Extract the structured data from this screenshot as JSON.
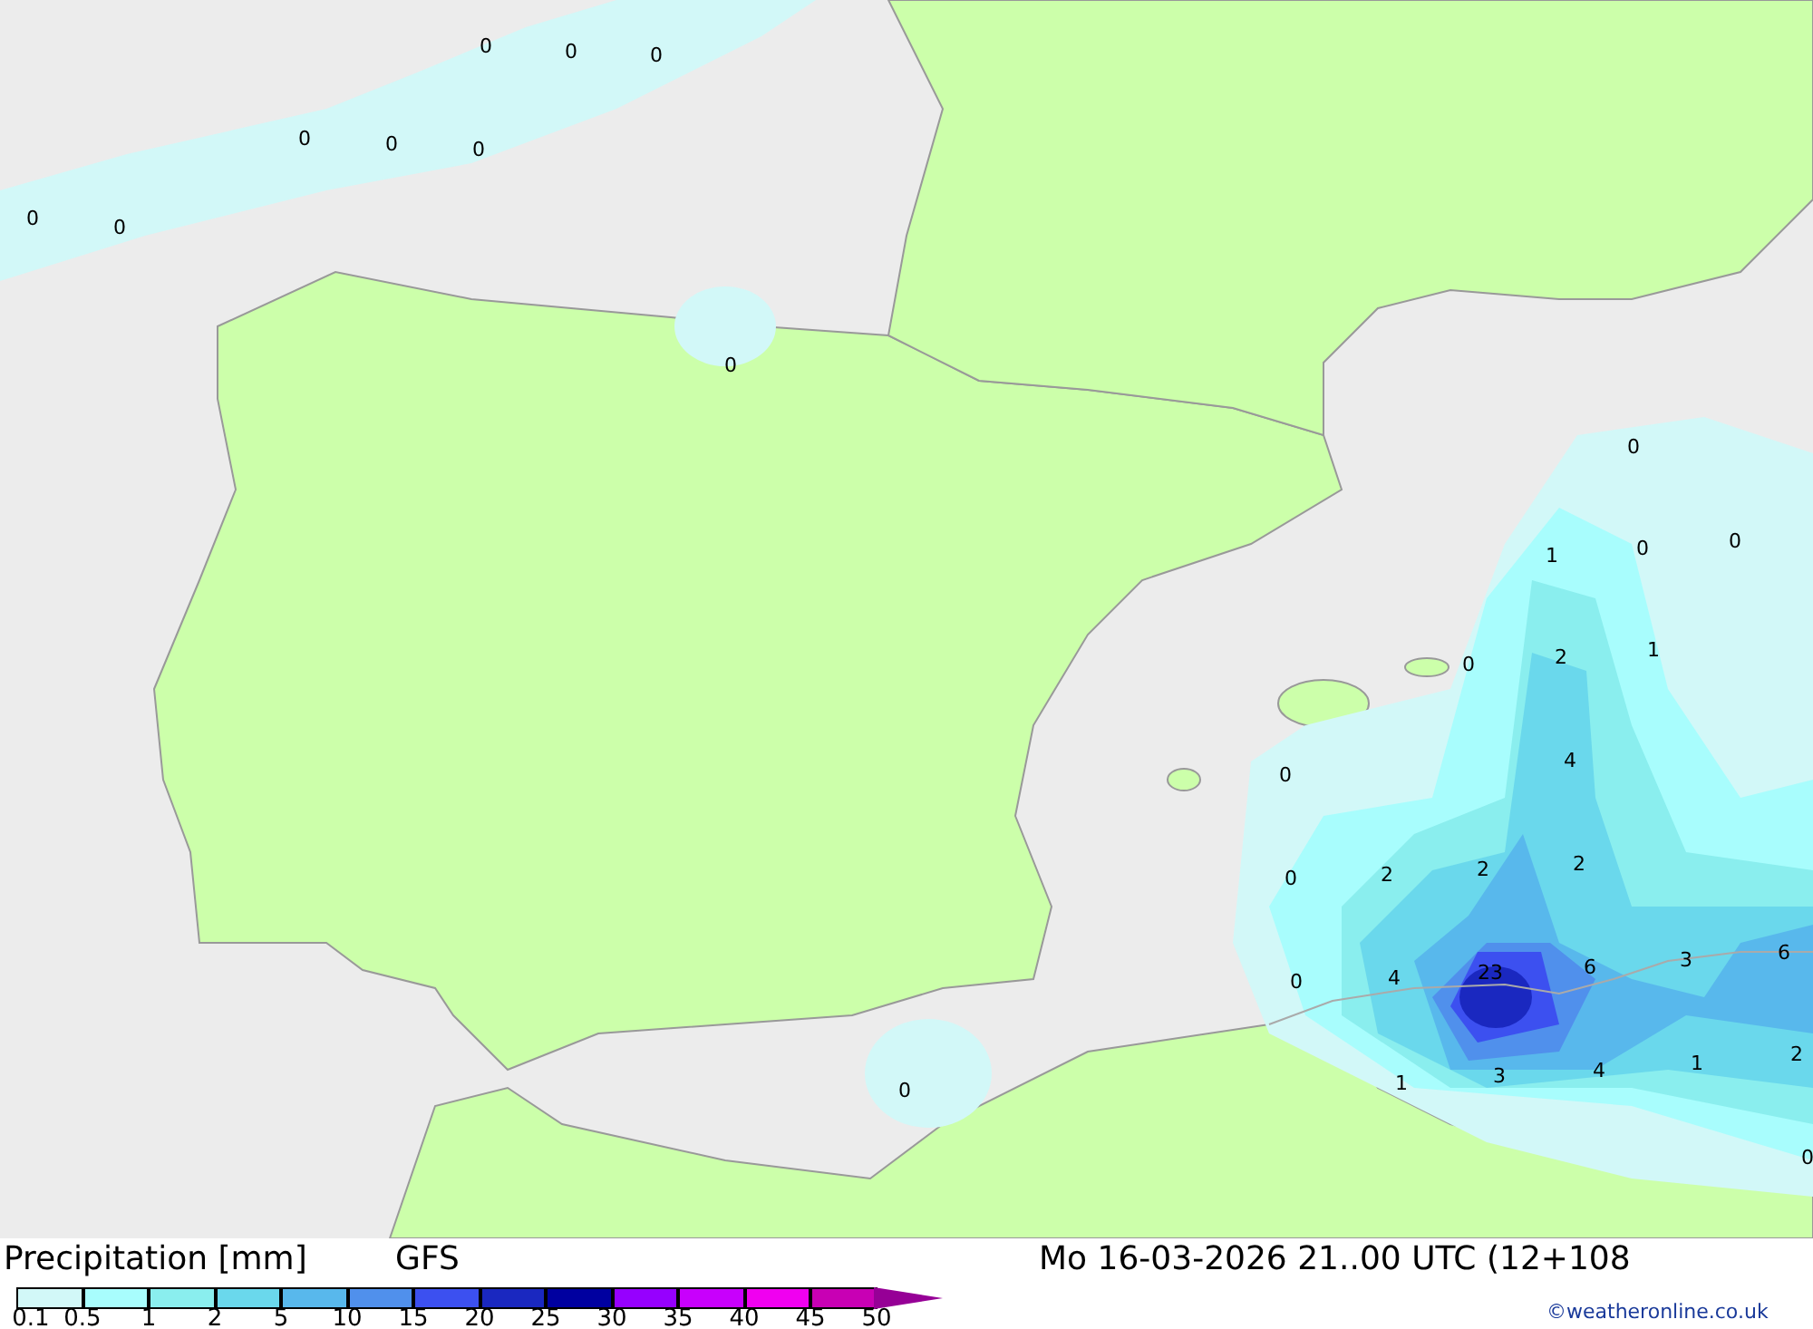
{
  "map": {
    "contour_labels": [
      "0",
      "0",
      "0",
      "0",
      "0",
      "0",
      "0",
      "0",
      "0",
      "0",
      "1",
      "0",
      "0",
      "0",
      "2",
      "1",
      "4",
      "0",
      "2",
      "0",
      "2",
      "2",
      "0",
      "4",
      "6",
      "3",
      "6",
      "23",
      "0",
      "1",
      "3",
      "4",
      "1",
      "2",
      "0"
    ]
  },
  "footer": {
    "title": "Precipitation [mm]",
    "model": "GFS",
    "valid_time": "Mo 16-03-2026 21..00 UTC (12+108",
    "credit": "©weatheronline.co.uk"
  },
  "legend": {
    "swatches": [
      {
        "color": "#d2f8f8"
      },
      {
        "color": "#a8fdfd"
      },
      {
        "color": "#8aeeee"
      },
      {
        "color": "#6ad8ec"
      },
      {
        "color": "#58b8ec"
      },
      {
        "color": "#5090ec"
      },
      {
        "color": "#3c50f0"
      },
      {
        "color": "#1a28c0"
      },
      {
        "color": "#0000a0"
      },
      {
        "color": "#9600fe"
      },
      {
        "color": "#c800fc"
      },
      {
        "color": "#f000f0"
      },
      {
        "color": "#c800b4"
      }
    ],
    "arrow": {
      "color": "#960096"
    },
    "ticks": [
      "0.1",
      "0.5",
      "1",
      "2",
      "5",
      "10",
      "15",
      "20",
      "25",
      "30",
      "35",
      "40",
      "45",
      "50"
    ]
  }
}
